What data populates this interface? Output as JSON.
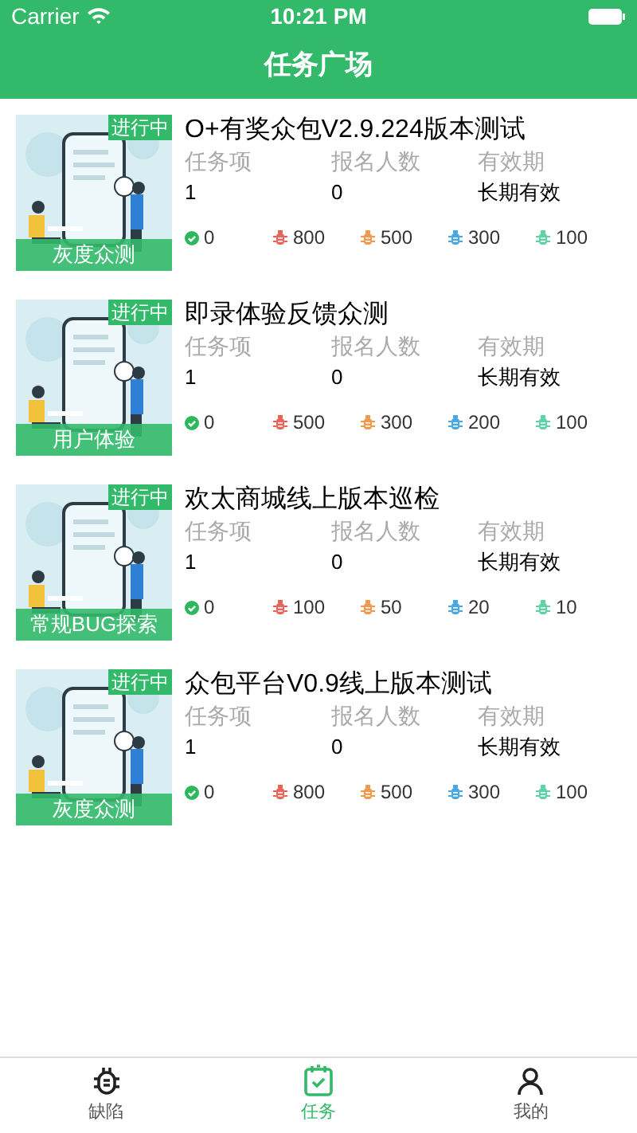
{
  "status_bar": {
    "carrier": "Carrier",
    "time": "10:21 PM"
  },
  "header": {
    "title": "任务广场"
  },
  "tasks": [
    {
      "title": "O+有奖众包V2.9.224版本测试",
      "badge": "进行中",
      "category": "灰度众测",
      "labels": [
        "任务项",
        "报名人数",
        "有效期"
      ],
      "values": [
        "1",
        "0",
        "长期有效"
      ],
      "stats": [
        {
          "kind": "passed",
          "color": "#2eb85c",
          "value": "0"
        },
        {
          "kind": "bug",
          "color": "#e8645a",
          "value": "800"
        },
        {
          "kind": "bug",
          "color": "#ef9a4f",
          "value": "500"
        },
        {
          "kind": "bug",
          "color": "#4aa7e0",
          "value": "300"
        },
        {
          "kind": "bug",
          "color": "#5fd3a6",
          "value": "100"
        }
      ]
    },
    {
      "title": "即录体验反馈众测",
      "badge": "进行中",
      "category": "用户体验",
      "labels": [
        "任务项",
        "报名人数",
        "有效期"
      ],
      "values": [
        "1",
        "0",
        "长期有效"
      ],
      "stats": [
        {
          "kind": "passed",
          "color": "#2eb85c",
          "value": "0"
        },
        {
          "kind": "bug",
          "color": "#e8645a",
          "value": "500"
        },
        {
          "kind": "bug",
          "color": "#ef9a4f",
          "value": "300"
        },
        {
          "kind": "bug",
          "color": "#4aa7e0",
          "value": "200"
        },
        {
          "kind": "bug",
          "color": "#5fd3a6",
          "value": "100"
        }
      ]
    },
    {
      "title": "欢太商城线上版本巡检",
      "badge": "进行中",
      "category": "常规BUG探索",
      "labels": [
        "任务项",
        "报名人数",
        "有效期"
      ],
      "values": [
        "1",
        "0",
        "长期有效"
      ],
      "stats": [
        {
          "kind": "passed",
          "color": "#2eb85c",
          "value": "0"
        },
        {
          "kind": "bug",
          "color": "#e8645a",
          "value": "100"
        },
        {
          "kind": "bug",
          "color": "#ef9a4f",
          "value": "50"
        },
        {
          "kind": "bug",
          "color": "#4aa7e0",
          "value": "20"
        },
        {
          "kind": "bug",
          "color": "#5fd3a6",
          "value": "10"
        }
      ]
    },
    {
      "title": "众包平台V0.9线上版本测试",
      "badge": "进行中",
      "category": "灰度众测",
      "labels": [
        "任务项",
        "报名人数",
        "有效期"
      ],
      "values": [
        "1",
        "0",
        "长期有效"
      ],
      "stats": [
        {
          "kind": "passed",
          "color": "#2eb85c",
          "value": "0"
        },
        {
          "kind": "bug",
          "color": "#e8645a",
          "value": "800"
        },
        {
          "kind": "bug",
          "color": "#ef9a4f",
          "value": "500"
        },
        {
          "kind": "bug",
          "color": "#4aa7e0",
          "value": "300"
        },
        {
          "kind": "bug",
          "color": "#5fd3a6",
          "value": "100"
        }
      ]
    }
  ],
  "tab_bar": [
    {
      "kind": "bug",
      "label": "缺陷",
      "selected": false
    },
    {
      "kind": "task",
      "label": "任务",
      "selected": true
    },
    {
      "kind": "me",
      "label": "我的",
      "selected": false
    }
  ]
}
